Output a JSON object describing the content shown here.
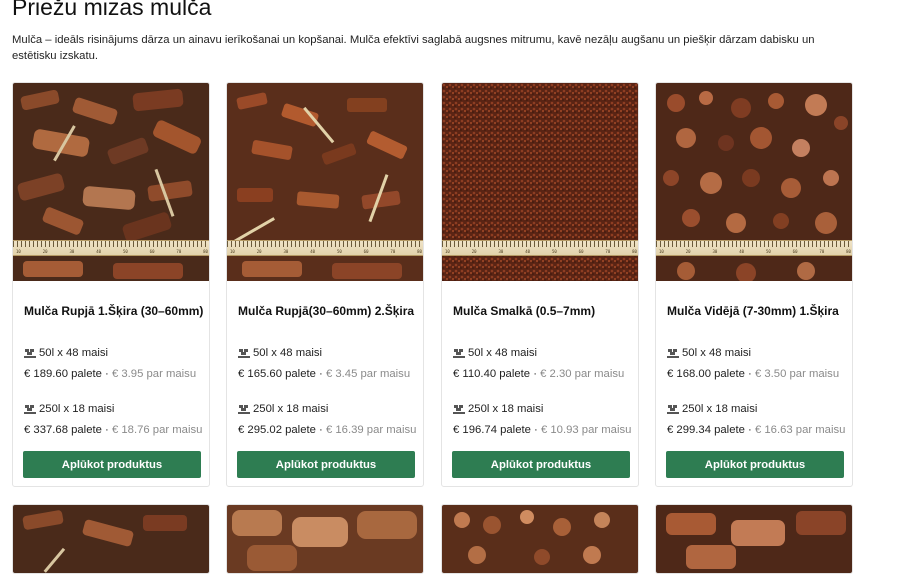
{
  "page": {
    "title": "Priežu mizas mulča",
    "description": "Mulča – ideāls risinājums dārza un ainavu ierīkošanai un kopšanai. Mulča efektīvi saglabā augsnes mitrumu, kavē nezāļu augšanu un piešķir dārzam dabisku un estētisku izskatu."
  },
  "button_label": "Aplūkot produktus",
  "icons": {
    "pallet": "pallet-icon"
  },
  "colors": {
    "button": "#2e7d52",
    "muted_price": "#8a8a8a"
  },
  "products": [
    {
      "name": "Mulča Rupjā 1.Šķira (30–60mm)",
      "options": [
        {
          "label": "50l x 48 maisi",
          "pallet": "€ 189.60 palete",
          "per_bag": "€ 3.95 par maisu"
        },
        {
          "label": "250l x 18 maisi",
          "pallet": "€ 337.68 palete",
          "per_bag": "€ 18.76 par maisu"
        }
      ]
    },
    {
      "name": "Mulča Rupjā(30–60mm) 2.Šķira",
      "options": [
        {
          "label": "50l x 48 maisi",
          "pallet": "€ 165.60 palete",
          "per_bag": "€ 3.45 par maisu"
        },
        {
          "label": "250l x 18 maisi",
          "pallet": "€ 295.02 palete",
          "per_bag": "€ 16.39 par maisu"
        }
      ]
    },
    {
      "name": "Mulča Smalkā (0.5–7mm)",
      "options": [
        {
          "label": "50l x 48 maisi",
          "pallet": "€ 110.40 palete",
          "per_bag": "€ 2.30 par maisu"
        },
        {
          "label": "250l x 18 maisi",
          "pallet": "€ 196.74 palete",
          "per_bag": "€ 10.93 par maisu"
        }
      ]
    },
    {
      "name": "Mulča Vidējā (7-30mm) 1.Šķira",
      "options": [
        {
          "label": "50l x 48 maisi",
          "pallet": "€ 168.00 palete",
          "per_bag": "€ 3.50 par maisu"
        },
        {
          "label": "250l x 18 maisi",
          "pallet": "€ 299.34 palete",
          "per_bag": "€ 16.63 par maisu"
        }
      ]
    }
  ]
}
